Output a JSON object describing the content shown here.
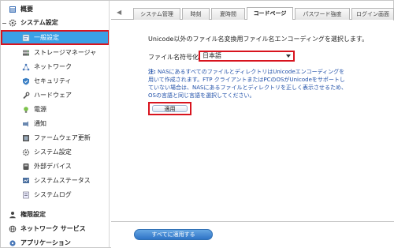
{
  "sidebar": {
    "overview": {
      "label": "概要"
    },
    "system_settings": {
      "label": "システム設定"
    },
    "items": [
      {
        "label": "一般設定"
      },
      {
        "label": "ストレージマネージャ"
      },
      {
        "label": "ネットワーク"
      },
      {
        "label": "セキュリティ"
      },
      {
        "label": "ハードウェア"
      },
      {
        "label": "電源"
      },
      {
        "label": "通知"
      },
      {
        "label": "ファームウェア更新"
      },
      {
        "label": "システム設定"
      },
      {
        "label": "外部デバイス"
      },
      {
        "label": "システムステータス"
      },
      {
        "label": "システムログ"
      }
    ],
    "privileges": {
      "label": "権限設定"
    },
    "network_services": {
      "label": "ネットワーク サービス"
    },
    "applications": {
      "label": "アプリケーション"
    }
  },
  "tabs": [
    {
      "label": "システム管理"
    },
    {
      "label": "時刻"
    },
    {
      "label": "夏時間"
    },
    {
      "label": "コードページ"
    },
    {
      "label": "パスワード強度"
    },
    {
      "label": "ログイン画面"
    }
  ],
  "active_tab": "コードページ",
  "main": {
    "description": "Unicode以外のファイル名変換用ファイル名エンコーディングを選択します。",
    "field_label": "ファイル名符号化:",
    "select_value": "日本語",
    "note_prefix": "注:",
    "note_text": " NASにあるすべてのファイルとディレクトリはUnicodeエンコーディングを用いて作成されます。FTP クライアントまたはPCのOSがUnicodeをサポートしていない場合は、NASにあるファイルとディレクトリを正しく表示させるため、OSの言語と同じ言語を選択してください。",
    "apply_label": "適用",
    "apply_all_label": "すべてに適用する"
  },
  "colors": {
    "selected_bg": "#3aa0e6",
    "highlight_border": "#d8141e",
    "note_text": "#1f4fa8",
    "primary_button": "#2e74c6"
  }
}
